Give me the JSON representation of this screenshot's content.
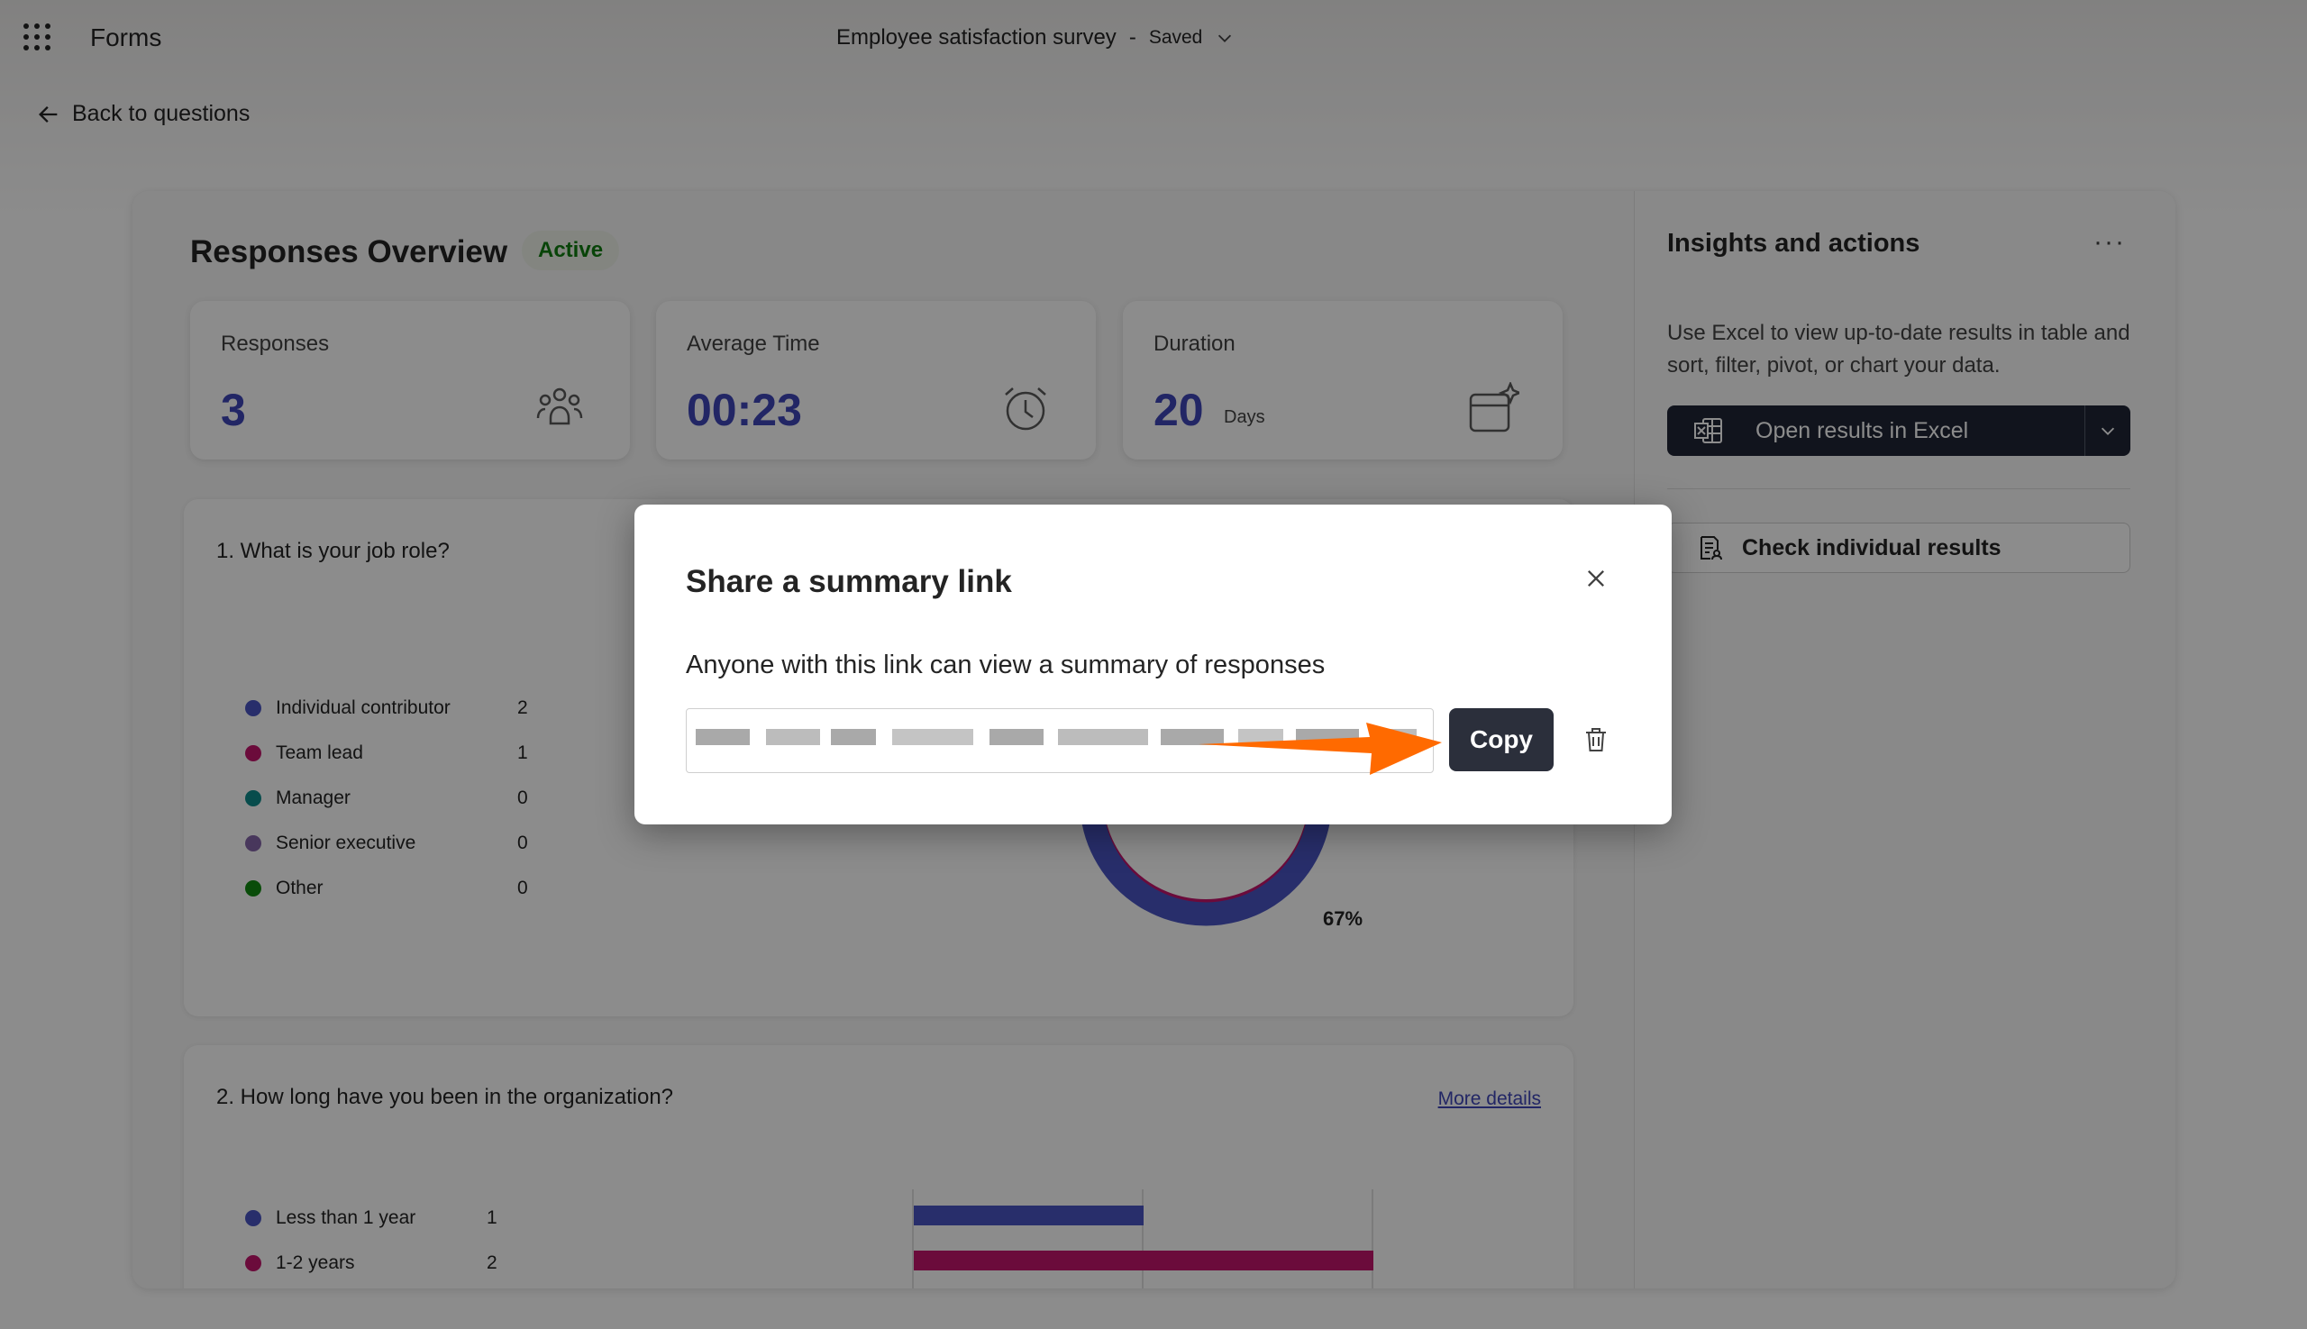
{
  "topbar": {
    "app_name": "Forms",
    "form_title": "Employee satisfaction survey",
    "separator": "-",
    "save_status": "Saved"
  },
  "nav": {
    "back_label": "Back to questions"
  },
  "overview": {
    "title": "Responses Overview",
    "status_badge": "Active",
    "stats": [
      {
        "label": "Responses",
        "value": "3",
        "unit": ""
      },
      {
        "label": "Average Time",
        "value": "00:23",
        "unit": ""
      },
      {
        "label": "Duration",
        "value": "20",
        "unit": "Days"
      }
    ]
  },
  "questions": [
    {
      "title": "1. What is your job role?",
      "options": [
        {
          "label": "Individual contributor",
          "count": "2"
        },
        {
          "label": "Team lead",
          "count": "1"
        },
        {
          "label": "Manager",
          "count": "0"
        },
        {
          "label": "Senior executive",
          "count": "0"
        },
        {
          "label": "Other",
          "count": "0"
        }
      ],
      "donut_label": "67%"
    },
    {
      "title": "2. How long have you been in the organization?",
      "more_details": "More details",
      "options": [
        {
          "label": "Less than 1 year",
          "count": "1"
        },
        {
          "label": "1-2 years",
          "count": "2"
        }
      ]
    }
  ],
  "insights": {
    "title": "Insights and actions",
    "menu_icon": "more-horizontal-icon",
    "description": "Use Excel to view up-to-date results in table and sort, filter, pivot, or chart your data.",
    "excel_button": "Open results in Excel",
    "check_button": "Check individual results"
  },
  "dialog": {
    "title": "Share a summary link",
    "description": "Anyone with this link can view a summary of responses",
    "copy_label": "Copy"
  },
  "colors": {
    "accent": "#3f46b8",
    "series_1": "#4a55c4",
    "series_2": "#c4156c",
    "series_3": "#0e8a8a",
    "series_4": "#8464a8",
    "series_5": "#118a11",
    "annotation_arrow": "#ff6a00",
    "active_badge": "#107c10"
  }
}
